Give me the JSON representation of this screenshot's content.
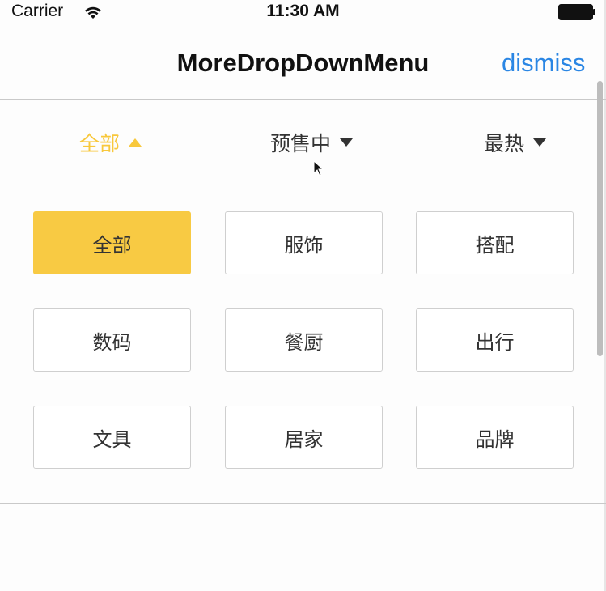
{
  "status_bar": {
    "carrier": "Carrier",
    "time": "11:30 AM",
    "icons": [
      "wifi-icon",
      "battery-icon"
    ]
  },
  "nav": {
    "title": "MoreDropDownMenu",
    "dismiss_label": "dismiss"
  },
  "filters": [
    {
      "label": "全部",
      "state": "expanded",
      "icon": "triangle-up-icon"
    },
    {
      "label": "预售中",
      "state": "collapsed",
      "icon": "triangle-down-icon"
    },
    {
      "label": "最热",
      "state": "collapsed",
      "icon": "triangle-down-icon"
    }
  ],
  "categories": [
    {
      "label": "全部",
      "selected": true
    },
    {
      "label": "服饰",
      "selected": false
    },
    {
      "label": "搭配",
      "selected": false
    },
    {
      "label": "数码",
      "selected": false
    },
    {
      "label": "餐厨",
      "selected": false
    },
    {
      "label": "出行",
      "selected": false
    },
    {
      "label": "文具",
      "selected": false
    },
    {
      "label": "居家",
      "selected": false
    },
    {
      "label": "品牌",
      "selected": false
    }
  ],
  "colors": {
    "accent": "#f8c83c",
    "link": "#2a86e4",
    "border": "#cfcfcf"
  }
}
